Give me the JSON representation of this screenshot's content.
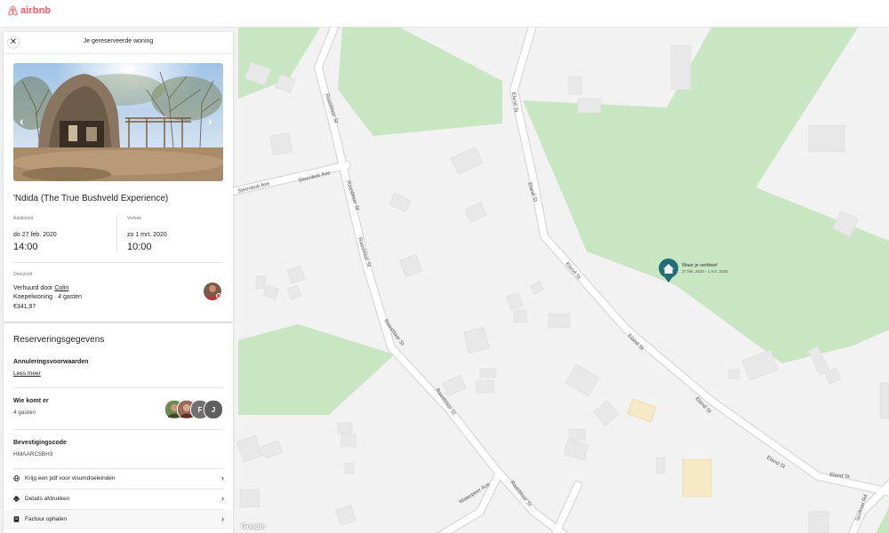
{
  "app": {
    "brand": "airbnb",
    "brand_color": "#ff5a5f"
  },
  "panel": {
    "header_title": "Je gereserveerde woning",
    "listing_title": "'Ndida (The True Bushveld Experience)",
    "checkin": {
      "label": "Aankomst",
      "date": "do 27 feb. 2020",
      "time": "14:00"
    },
    "checkout": {
      "label": "Vertrek",
      "date": "zo 1 mrt. 2020",
      "time": "10:00"
    },
    "overview": {
      "label": "Overzicht",
      "host_prefix": "Verhuurd door",
      "host_name": "Colin",
      "type_guests": "Koepelwoning · 4 gasten",
      "price": "€341,97"
    }
  },
  "details": {
    "title": "Reserveringsgegevens",
    "cancellation": {
      "label": "Annuleringsvoorwaarden",
      "link": "Lees meer"
    },
    "guests": {
      "label": "Wie komt er",
      "value": "4 gasten",
      "initials": [
        "F",
        "J"
      ]
    },
    "confirmation": {
      "label": "Bevestigingscode",
      "value": "HMAARC5BH3"
    },
    "actions": [
      {
        "label": "Krijg een pdf voor visumdoeleinden",
        "icon": "globe-icon"
      },
      {
        "label": "Details afdrukken",
        "icon": "printer-icon"
      },
      {
        "label": "Factuur ophalen",
        "icon": "receipt-icon"
      }
    ]
  },
  "map": {
    "pin": {
      "title": "Waar je verbleef",
      "dates": "27 feb. 2020 - 1 mrt. 2020",
      "color": "#1f6f7a"
    },
    "streets": [
      "Raasblaar St",
      "Steenbok Ave",
      "Eland St",
      "Waterpeer Ave",
      "Seekoei Rd"
    ],
    "attribution": "Google"
  }
}
